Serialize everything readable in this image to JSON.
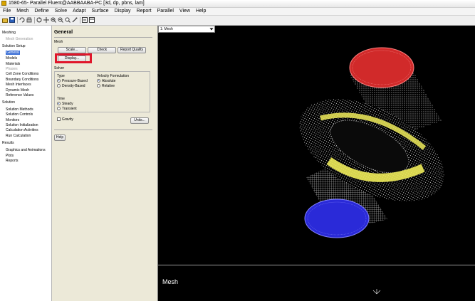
{
  "window": {
    "title": "1580-65- Parallel Fluent@AABBAABA-PC  [3d, dp, pbns, lam]"
  },
  "menu": [
    "File",
    "Mesh",
    "Define",
    "Solve",
    "Adapt",
    "Surface",
    "Display",
    "Report",
    "Parallel",
    "View",
    "Help"
  ],
  "toolbar_icons": [
    "open-icon",
    "save-icon",
    "undo-icon",
    "print-icon",
    "rotate-icon",
    "pan-icon",
    "zoom-in-icon",
    "zoom-out-icon",
    "zoom-fit-icon",
    "probe-icon",
    "fit-window-icon",
    "layout-icon"
  ],
  "tree": {
    "items": [
      {
        "label": "Meshing",
        "level": 0,
        "state": "normal"
      },
      {
        "label": "Mesh Generation",
        "level": 1,
        "state": "disabled"
      },
      {
        "label": "Solution Setup",
        "level": 0,
        "state": "normal"
      },
      {
        "label": "General",
        "level": 1,
        "state": "selected"
      },
      {
        "label": "Models",
        "level": 1,
        "state": "normal"
      },
      {
        "label": "Materials",
        "level": 1,
        "state": "normal"
      },
      {
        "label": "Phases",
        "level": 1,
        "state": "disabled"
      },
      {
        "label": "Cell Zone Conditions",
        "level": 1,
        "state": "normal"
      },
      {
        "label": "Boundary Conditions",
        "level": 1,
        "state": "normal"
      },
      {
        "label": "Mesh Interfaces",
        "level": 1,
        "state": "normal"
      },
      {
        "label": "Dynamic Mesh",
        "level": 1,
        "state": "normal"
      },
      {
        "label": "Reference Values",
        "level": 1,
        "state": "normal"
      },
      {
        "label": "Solution",
        "level": 0,
        "state": "normal"
      },
      {
        "label": "Solution Methods",
        "level": 1,
        "state": "normal"
      },
      {
        "label": "Solution Controls",
        "level": 1,
        "state": "normal"
      },
      {
        "label": "Monitors",
        "level": 1,
        "state": "normal"
      },
      {
        "label": "Solution Initialization",
        "level": 1,
        "state": "normal"
      },
      {
        "label": "Calculation Activities",
        "level": 1,
        "state": "normal"
      },
      {
        "label": "Run Calculation",
        "level": 1,
        "state": "normal"
      },
      {
        "label": "Results",
        "level": 0,
        "state": "normal"
      },
      {
        "label": "Graphics and Animations",
        "level": 1,
        "state": "normal"
      },
      {
        "label": "Plots",
        "level": 1,
        "state": "normal"
      },
      {
        "label": "Reports",
        "level": 1,
        "state": "normal"
      }
    ]
  },
  "panel": {
    "title": "General",
    "mesh_label": "Mesh",
    "buttons": {
      "scale": "Scale...",
      "check": "Check",
      "report_quality": "Report Quality",
      "display": "Display..."
    },
    "solver_label": "Solver",
    "type_label": "Type",
    "type_options": [
      "Pressure-Based",
      "Density-Based"
    ],
    "velocity_label": "Velocity Formulation",
    "velocity_options": [
      "Absolute",
      "Relative"
    ],
    "time_label": "Time",
    "time_options": [
      "Steady",
      "Transient"
    ],
    "gravity_label": "Gravity",
    "units_button": "Units...",
    "help_button": "Help"
  },
  "viewer": {
    "selector": "1: Mesh",
    "caption": "Mesh",
    "colors": {
      "inlet": "#d12a2a",
      "outlet": "#2a2ad8",
      "interface": "#f0ec5a",
      "wireframe": "#ffffff",
      "background": "#000000"
    }
  }
}
